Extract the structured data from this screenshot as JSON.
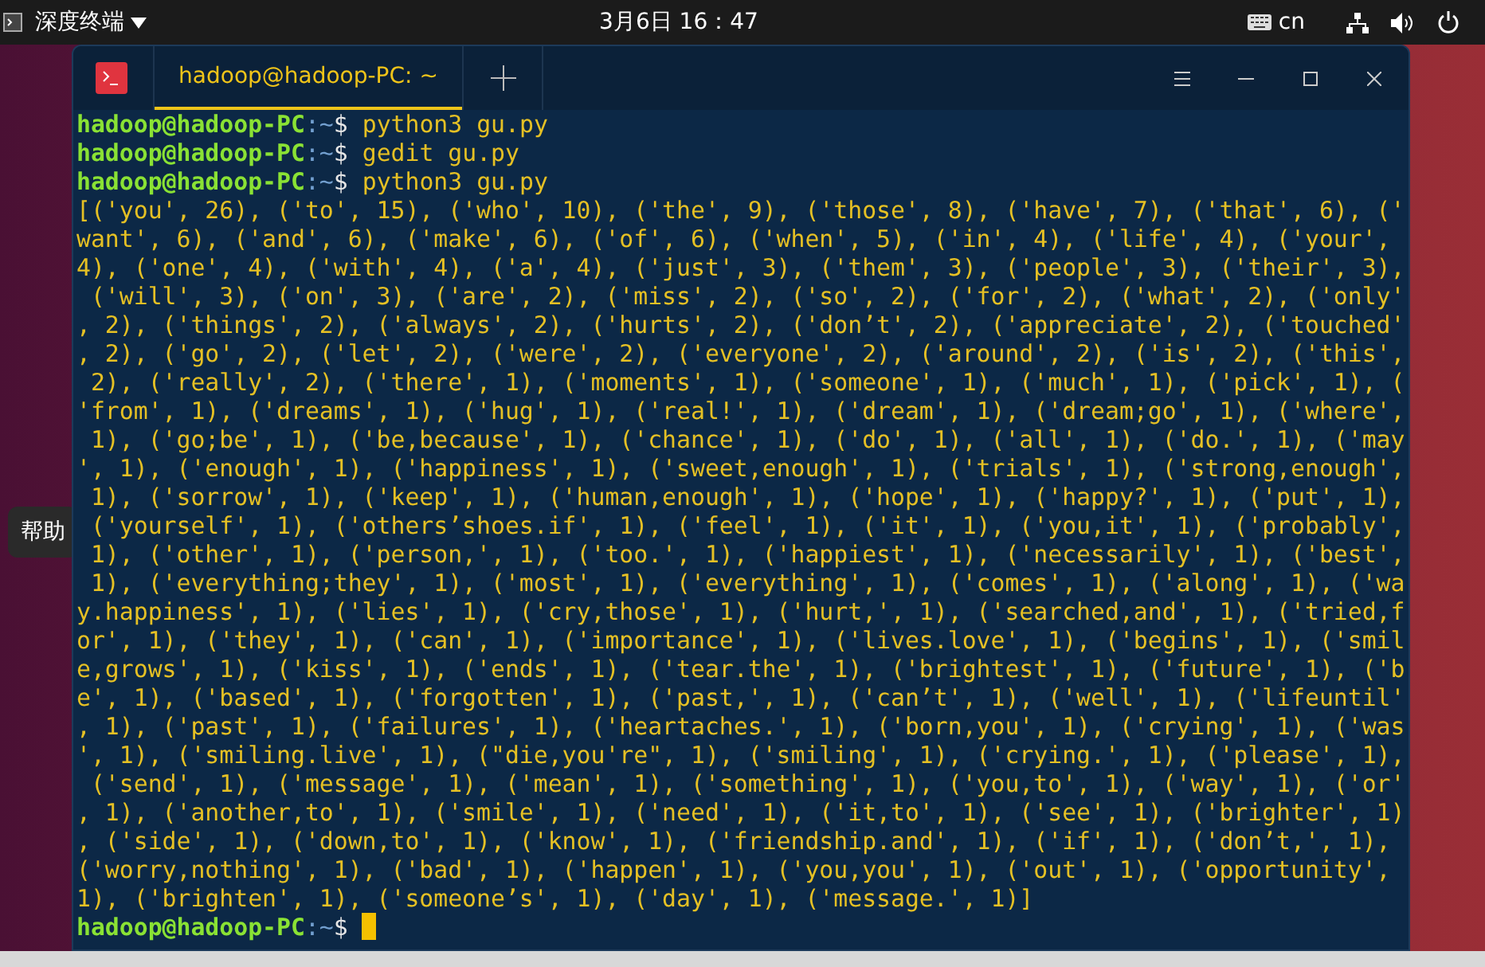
{
  "top_bar": {
    "app_name": "深度终端",
    "datetime": "3月6日 16：47",
    "keyboard_layout": "cn"
  },
  "desktop": {
    "tooltip": "帮助"
  },
  "terminal": {
    "tab_title": "hadoop@hadoop-PC: ~",
    "tab_selected": true,
    "lines": [
      {
        "kind": "prompt",
        "user": "hadoop@hadoop-PC",
        "path": ":~",
        "symbol": "$",
        "command": "python3 gu.py"
      },
      {
        "kind": "prompt",
        "user": "hadoop@hadoop-PC",
        "path": ":~",
        "symbol": "$",
        "command": "gedit gu.py"
      },
      {
        "kind": "prompt",
        "user": "hadoop@hadoop-PC",
        "path": ":~",
        "symbol": "$",
        "command": "python3 gu.py"
      },
      {
        "kind": "output",
        "text": "[('you', 26), ('to', 15), ('who', 10), ('the', 9), ('those', 8), ('have', 7), ('that', 6), ('"
      },
      {
        "kind": "output",
        "text": "want', 6), ('and', 6), ('make', 6), ('of', 6), ('when', 5), ('in', 4), ('life', 4), ('your',"
      },
      {
        "kind": "output",
        "text": "4), ('one', 4), ('with', 4), ('a', 4), ('just', 3), ('them', 3), ('people', 3), ('their', 3),"
      },
      {
        "kind": "output",
        "text": " ('will', 3), ('on', 3), ('are', 2), ('miss', 2), ('so', 2), ('for', 2), ('what', 2), ('only'"
      },
      {
        "kind": "output",
        "text": ", 2), ('things', 2), ('always', 2), ('hurts', 2), ('don’t', 2), ('appreciate', 2), ('touched'"
      },
      {
        "kind": "output",
        "text": ", 2), ('go', 2), ('let', 2), ('were', 2), ('everyone', 2), ('around', 2), ('is', 2), ('this',"
      },
      {
        "kind": "output",
        "text": " 2), ('really', 2), ('there', 1), ('moments', 1), ('someone', 1), ('much', 1), ('pick', 1), ("
      },
      {
        "kind": "output",
        "text": "'from', 1), ('dreams', 1), ('hug', 1), ('real!', 1), ('dream', 1), ('dream;go', 1), ('where',"
      },
      {
        "kind": "output",
        "text": " 1), ('go;be', 1), ('be,because', 1), ('chance', 1), ('do', 1), ('all', 1), ('do.', 1), ('may"
      },
      {
        "kind": "output",
        "text": "', 1), ('enough', 1), ('happiness', 1), ('sweet,enough', 1), ('trials', 1), ('strong,enough',"
      },
      {
        "kind": "output",
        "text": " 1), ('sorrow', 1), ('keep', 1), ('human,enough', 1), ('hope', 1), ('happy?', 1), ('put', 1),"
      },
      {
        "kind": "output",
        "text": " ('yourself', 1), ('others’shoes.if', 1), ('feel', 1), ('it', 1), ('you,it', 1), ('probably',"
      },
      {
        "kind": "output",
        "text": " 1), ('other', 1), ('person,', 1), ('too.', 1), ('happiest', 1), ('necessarily', 1), ('best',"
      },
      {
        "kind": "output",
        "text": " 1), ('everything;they', 1), ('most', 1), ('everything', 1), ('comes', 1), ('along', 1), ('wa"
      },
      {
        "kind": "output",
        "text": "y.happiness', 1), ('lies', 1), ('cry,those', 1), ('hurt,', 1), ('searched,and', 1), ('tried,f"
      },
      {
        "kind": "output",
        "text": "or', 1), ('they', 1), ('can', 1), ('importance', 1), ('lives.love', 1), ('begins', 1), ('smil"
      },
      {
        "kind": "output",
        "text": "e,grows', 1), ('kiss', 1), ('ends', 1), ('tear.the', 1), ('brightest', 1), ('future', 1), ('b"
      },
      {
        "kind": "output",
        "text": "e', 1), ('based', 1), ('forgotten', 1), ('past,', 1), ('can’t', 1), ('well', 1), ('lifeuntil'"
      },
      {
        "kind": "output",
        "text": ", 1), ('past', 1), ('failures', 1), ('heartaches.', 1), ('born,you', 1), ('crying', 1), ('was"
      },
      {
        "kind": "output",
        "text": "', 1), ('smiling.live', 1), (\"die,you're\", 1), ('smiling', 1), ('crying.', 1), ('please', 1),"
      },
      {
        "kind": "output",
        "text": " ('send', 1), ('message', 1), ('mean', 1), ('something', 1), ('you,to', 1), ('way', 1), ('or'"
      },
      {
        "kind": "output",
        "text": ", 1), ('another,to', 1), ('smile', 1), ('need', 1), ('it,to', 1), ('see', 1), ('brighter', 1)"
      },
      {
        "kind": "output",
        "text": ", ('side', 1), ('down,to', 1), ('know', 1), ('friendship.and', 1), ('if', 1), ('don’t,', 1),"
      },
      {
        "kind": "output",
        "text": "('worry,nothing', 1), ('bad', 1), ('happen', 1), ('you,you', 1), ('out', 1), ('opportunity',"
      },
      {
        "kind": "output",
        "text": "1), ('brighten', 1), ('someone’s', 1), ('day', 1), ('message.', 1)]"
      },
      {
        "kind": "prompt",
        "user": "hadoop@hadoop-PC",
        "path": ":~",
        "symbol": "$",
        "cursor": true
      }
    ]
  }
}
